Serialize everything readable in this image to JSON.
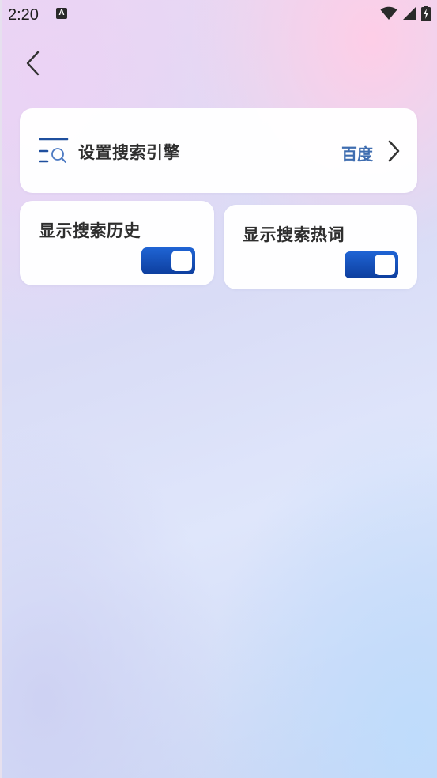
{
  "status_bar": {
    "time": "2:20",
    "notification_icon": "a-icon",
    "icons": [
      "wifi-icon",
      "signal-icon",
      "battery-charging-icon"
    ]
  },
  "nav": {
    "back_icon": "chevron-left-icon"
  },
  "search_engine": {
    "label": "设置搜索引擎",
    "value": "百度",
    "icon": "search-list-icon"
  },
  "toggles": {
    "history": {
      "label": "显示搜索历史",
      "enabled": true
    },
    "hot_words": {
      "label": "显示搜索热词",
      "enabled": true
    }
  },
  "colors": {
    "accent": "#3f6db0",
    "toggle_on": "#1a56c4",
    "text_primary": "#2e2e2e"
  }
}
